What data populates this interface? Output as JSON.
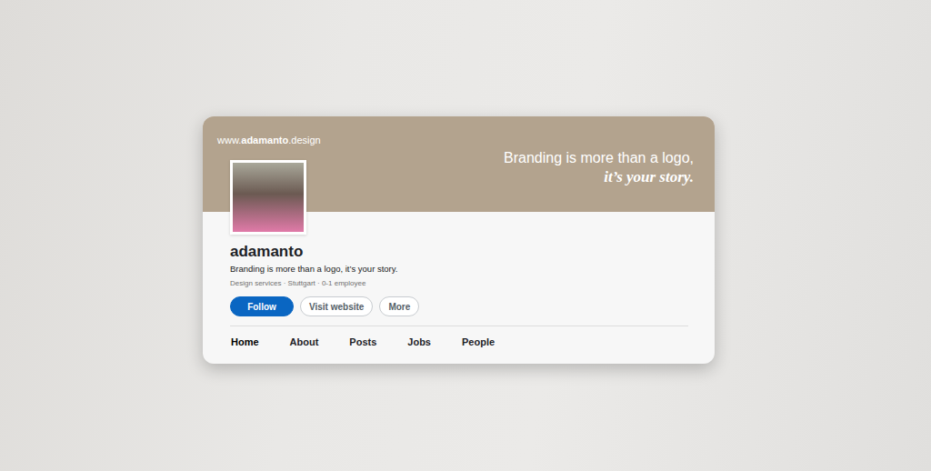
{
  "banner": {
    "website": {
      "prefix": "www.",
      "name": "adamanto",
      "suffix": ".design"
    },
    "tagline_line1": "Branding is more than a logo,",
    "tagline_line2": "it’s your story."
  },
  "profile": {
    "name": "adamanto",
    "tagline": "Branding is more than a logo, it’s your story.",
    "meta": "Design services · Stuttgart · 0-1 employee"
  },
  "buttons": [
    {
      "label": "Follow",
      "kind": "primary"
    },
    {
      "label": "Visit website",
      "kind": "outline"
    },
    {
      "label": "More",
      "kind": "outline"
    }
  ],
  "tabs": [
    {
      "label": "Home",
      "selected": true
    },
    {
      "label": "About",
      "selected": false
    },
    {
      "label": "Posts",
      "selected": false
    },
    {
      "label": "Jobs",
      "selected": false
    },
    {
      "label": "People",
      "selected": false
    }
  ]
}
